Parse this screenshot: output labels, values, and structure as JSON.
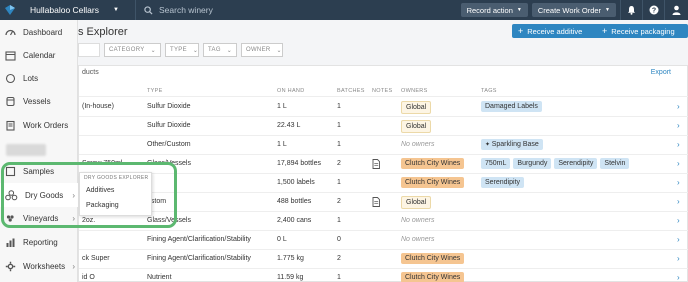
{
  "topbar": {
    "winery_name": "Hullabaloo Cellars",
    "search_placeholder": "Search winery",
    "record_action_label": "Record action",
    "create_work_order_label": "Create Work Order"
  },
  "sidebar": {
    "items": [
      {
        "label": "Dashboard",
        "icon": "dashboard-icon"
      },
      {
        "label": "Calendar",
        "icon": "calendar-icon"
      },
      {
        "label": "Lots",
        "icon": "lots-icon"
      },
      {
        "label": "Vessels",
        "icon": "vessels-icon"
      },
      {
        "label": "Work Orders",
        "icon": "work-orders-icon"
      },
      {
        "label": "Samples",
        "icon": "samples-icon"
      },
      {
        "label": "Dry Goods",
        "icon": "dry-goods-icon"
      },
      {
        "label": "Vineyards",
        "icon": "vineyards-icon"
      },
      {
        "label": "Reporting",
        "icon": "reporting-icon"
      },
      {
        "label": "Worksheets",
        "icon": "worksheets-icon"
      }
    ]
  },
  "flyout": {
    "heading": "DRY GOODS EXPLORER",
    "items": [
      "Additives",
      "Packaging"
    ]
  },
  "page": {
    "title": "s Explorer",
    "receive_additive_label": "Receive additive",
    "receive_packaging_label": "Receive packaging",
    "filters": [
      "CATEGORY",
      "TYPE",
      "TAG",
      "OWNER"
    ],
    "card_label": "ducts",
    "export_label": "Export"
  },
  "table": {
    "headers": [
      "TYPE",
      "ON HAND",
      "BATCHES",
      "NOTES",
      "OWNERS",
      "TAGS"
    ],
    "rows": [
      {
        "name": "(In-house)",
        "type": "Sulfur Dioxide",
        "on_hand": "1 L",
        "batches": "1",
        "notes": false,
        "owners": [
          {
            "kind": "global",
            "label": "Global"
          }
        ],
        "tags": [
          "Damaged Labels"
        ]
      },
      {
        "name": "",
        "type": "Sulfur Dioxide",
        "on_hand": "22.43 L",
        "batches": "1",
        "notes": false,
        "owners": [
          {
            "kind": "global",
            "label": "Global"
          }
        ],
        "tags": []
      },
      {
        "name": "",
        "type": "Other/Custom",
        "on_hand": "1 L",
        "batches": "1",
        "notes": false,
        "owners": [],
        "tags": [
          "Sparkling Base"
        ]
      },
      {
        "name": "Screw 750ml",
        "type": "Glass/Vessels",
        "on_hand": "17,894 bottles",
        "batches": "2",
        "notes": true,
        "owners": [
          {
            "kind": "clutch",
            "label": "Clutch City Wines"
          }
        ],
        "tags": [
          "750mL",
          "Burgundy",
          "Serendipity",
          "Stelvin"
        ]
      },
      {
        "name": "",
        "type": "",
        "on_hand": "1,500 labels",
        "batches": "1",
        "notes": false,
        "owners": [
          {
            "kind": "clutch",
            "label": "Clutch City Wines"
          }
        ],
        "tags": [
          "Serendipity"
        ]
      },
      {
        "name": "",
        "type": "ustom",
        "on_hand": "488 bottles",
        "batches": "2",
        "notes": true,
        "owners": [
          {
            "kind": "global",
            "label": "Global"
          }
        ],
        "tags": []
      },
      {
        "name": "2oz.",
        "type": "Glass/Vessels",
        "on_hand": "2,400 cans",
        "batches": "1",
        "notes": false,
        "owners": [],
        "tags": []
      },
      {
        "name": "",
        "type": "Fining Agent/Clarification/Stability",
        "on_hand": "0 L",
        "batches": "0",
        "notes": false,
        "owners": [],
        "tags": []
      },
      {
        "name": "ck Super",
        "type": "Fining Agent/Clarification/Stability",
        "on_hand": "1.775 kg",
        "batches": "2",
        "notes": false,
        "owners": [
          {
            "kind": "clutch",
            "label": "Clutch City Wines"
          }
        ],
        "tags": []
      },
      {
        "name": "id O",
        "type": "Nutrient",
        "on_hand": "11.59 kg",
        "batches": "1",
        "notes": false,
        "owners": [
          {
            "kind": "clutch",
            "label": "Clutch City Wines"
          }
        ],
        "tags": []
      }
    ],
    "no_owners_label": "No owners"
  },
  "colors": {
    "topbar": "#2c3e50",
    "primary": "#2e86c1",
    "owner_clutch": "#f5c591",
    "owner_global": "#fdf5e4",
    "tag": "#cfe4f4",
    "highlight": "#5cb870"
  }
}
